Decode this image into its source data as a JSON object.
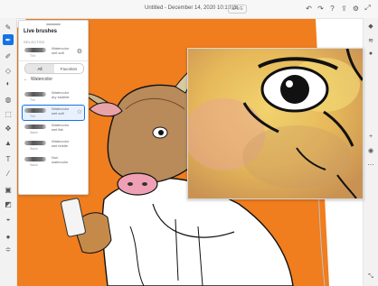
{
  "app": {
    "doc_title": "Untitled - December 14, 2020 10:10:26",
    "saved_badge": "SAVE"
  },
  "top_icons": [
    {
      "name": "undo-icon",
      "glyph": "↶"
    },
    {
      "name": "redo-icon",
      "glyph": "↷"
    },
    {
      "name": "help-icon",
      "glyph": "?"
    },
    {
      "name": "share-icon",
      "glyph": "⇪"
    },
    {
      "name": "settings-icon",
      "glyph": "⚙"
    },
    {
      "name": "fullscreen-icon",
      "glyph": "⤢"
    }
  ],
  "brushes_panel": {
    "title": "Live brushes",
    "selected_heading": "SELECTED",
    "selected_brush": {
      "name": "Watercolor wet soft",
      "size": "Tint"
    },
    "tabs": [
      "All",
      "Favorites"
    ],
    "active_tab": "All",
    "category": "Watercolor",
    "brushes": [
      {
        "name": "Watercolor dry stubble",
        "size": "Tint"
      },
      {
        "name": "Watercolor wet soft",
        "size": "Tint"
      },
      {
        "name": "Watercolor wet flat",
        "size": "Wash"
      },
      {
        "name": "Watercolor wet bristle",
        "size": "Wash"
      },
      {
        "name": "Non watercolor",
        "size": "Wash"
      }
    ]
  },
  "colors": {
    "accent": "#1473e6",
    "canvas_orange": "#f07d1e",
    "bull_tan": "#b98a5a",
    "wash_yellow": "#ecc94e"
  }
}
